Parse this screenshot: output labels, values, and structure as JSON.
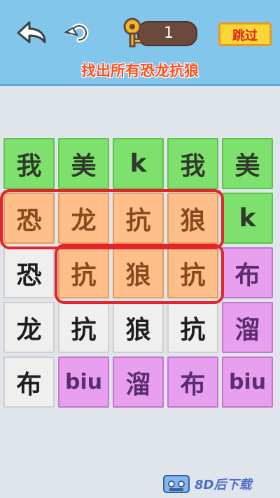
{
  "header": {
    "key_count": "1",
    "skip_label": "跳过",
    "instruction": "找出所有恐龙抗狼"
  },
  "grid": [
    [
      "我",
      "美",
      "k",
      "我",
      "美"
    ],
    [
      "恐",
      "龙",
      "抗",
      "狼",
      "k"
    ],
    [
      "恐",
      "抗",
      "狼",
      "抗",
      "布"
    ],
    [
      "龙",
      "抗",
      "狼",
      "抗",
      "溜"
    ],
    [
      "布",
      "biu",
      "溜",
      "布",
      "biu"
    ]
  ],
  "footer": {
    "brand": "8D后下载"
  },
  "colors": {
    "header_bg": "#83c6ec",
    "selected_outline": "#e3242a",
    "green": "#7fe16d",
    "orange": "#ffbf8a",
    "gray": "#efefef",
    "purple": "#e99ff0"
  }
}
